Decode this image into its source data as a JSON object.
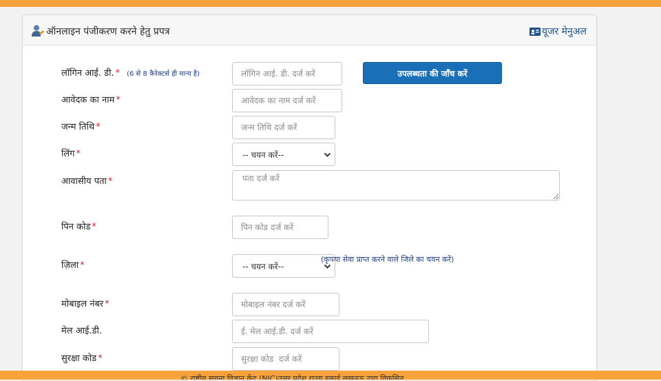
{
  "header": {
    "title": "ऑनलाइन पंजीकरण करने हेतु प्रपत्र",
    "manual_label": "यूजर मेनुअल"
  },
  "form": {
    "login_id": {
      "label": "लॉगिन आई. डी.",
      "required": "*",
      "hint": "(6 से 8 कैरेक्टर्स ही मान्य है)",
      "placeholder": "लॉगिन आई. डी. दर्ज करें"
    },
    "check_button": "उपलब्धता की जाँच करें",
    "applicant_name": {
      "label": "आवेदक का नाम",
      "required": "*",
      "placeholder": "आवेदक का नाम दर्ज करें"
    },
    "dob": {
      "label": "जन्म तिथि",
      "required": "*",
      "placeholder": "जन्म तिथि दर्ज करें"
    },
    "gender": {
      "label": "लिंग",
      "required": "*",
      "selected": "-- चयन करें--"
    },
    "address": {
      "label": "आवासीय पता",
      "required": "*",
      "placeholder": "पता दर्ज करें"
    },
    "pincode": {
      "label": "पिन कोड",
      "required": "*",
      "placeholder": "पिन कोड दर्ज करें"
    },
    "district": {
      "label": "ज़िला",
      "required": "*",
      "selected": "-- चयन करें--",
      "note": "(कृपया सेवा प्राप्त करने वाले जिले का चयन करें)"
    },
    "mobile": {
      "label": "मोबाइल नंबर",
      "required": "*",
      "placeholder": "मोबाइल नंबर दर्ज करें"
    },
    "email": {
      "label": "मेल आई.डी.",
      "placeholder": "ई. मेल आई.डी. दर्ज करें"
    },
    "captcha": {
      "label": "सुरक्षा कोड",
      "required": "*",
      "placeholder": "सुरक्षा कोड  दर्ज करें"
    }
  },
  "footer": {
    "text": "© राष्ट्रीय सूचना विज्ञान केंद्र (NIC)उत्तर प्रदेश राज्य इकाई लखनऊ द्वारा विकसित"
  },
  "colors": {
    "accent_bar": "#f7a23b",
    "button": "#1a6fb6",
    "required": "#d9252a",
    "link": "#1a4f8a"
  },
  "icons": [
    "user-edit-icon",
    "id-card-icon",
    "chevron-down-icon"
  ]
}
